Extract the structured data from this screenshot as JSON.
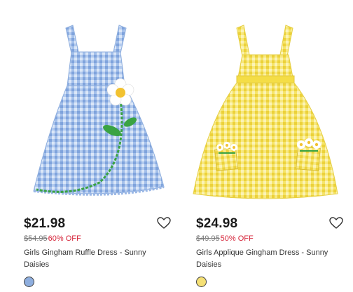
{
  "products": [
    {
      "price": "$21.98",
      "original_price": "$54.95",
      "discount": "60% OFF",
      "name": "Girls Gingham Ruffle Dress - Sunny Daisies",
      "swatch_color": "#8eaede",
      "image_icon": "blue-gingham-dress-image"
    },
    {
      "price": "$24.98",
      "original_price": "$49.95",
      "discount": "50% OFF",
      "name": "Girls Applique Gingham Dress - Sunny Daisies",
      "swatch_color": "#f5e075",
      "image_icon": "yellow-gingham-dress-image"
    }
  ],
  "colors": {
    "sale_red": "#d6253a",
    "price_text": "#1a1a1a",
    "blue_gingham": "#a9c4ec",
    "yellow_gingham": "#f6e770"
  },
  "icons": {
    "wishlist": "heart-outline-icon"
  }
}
